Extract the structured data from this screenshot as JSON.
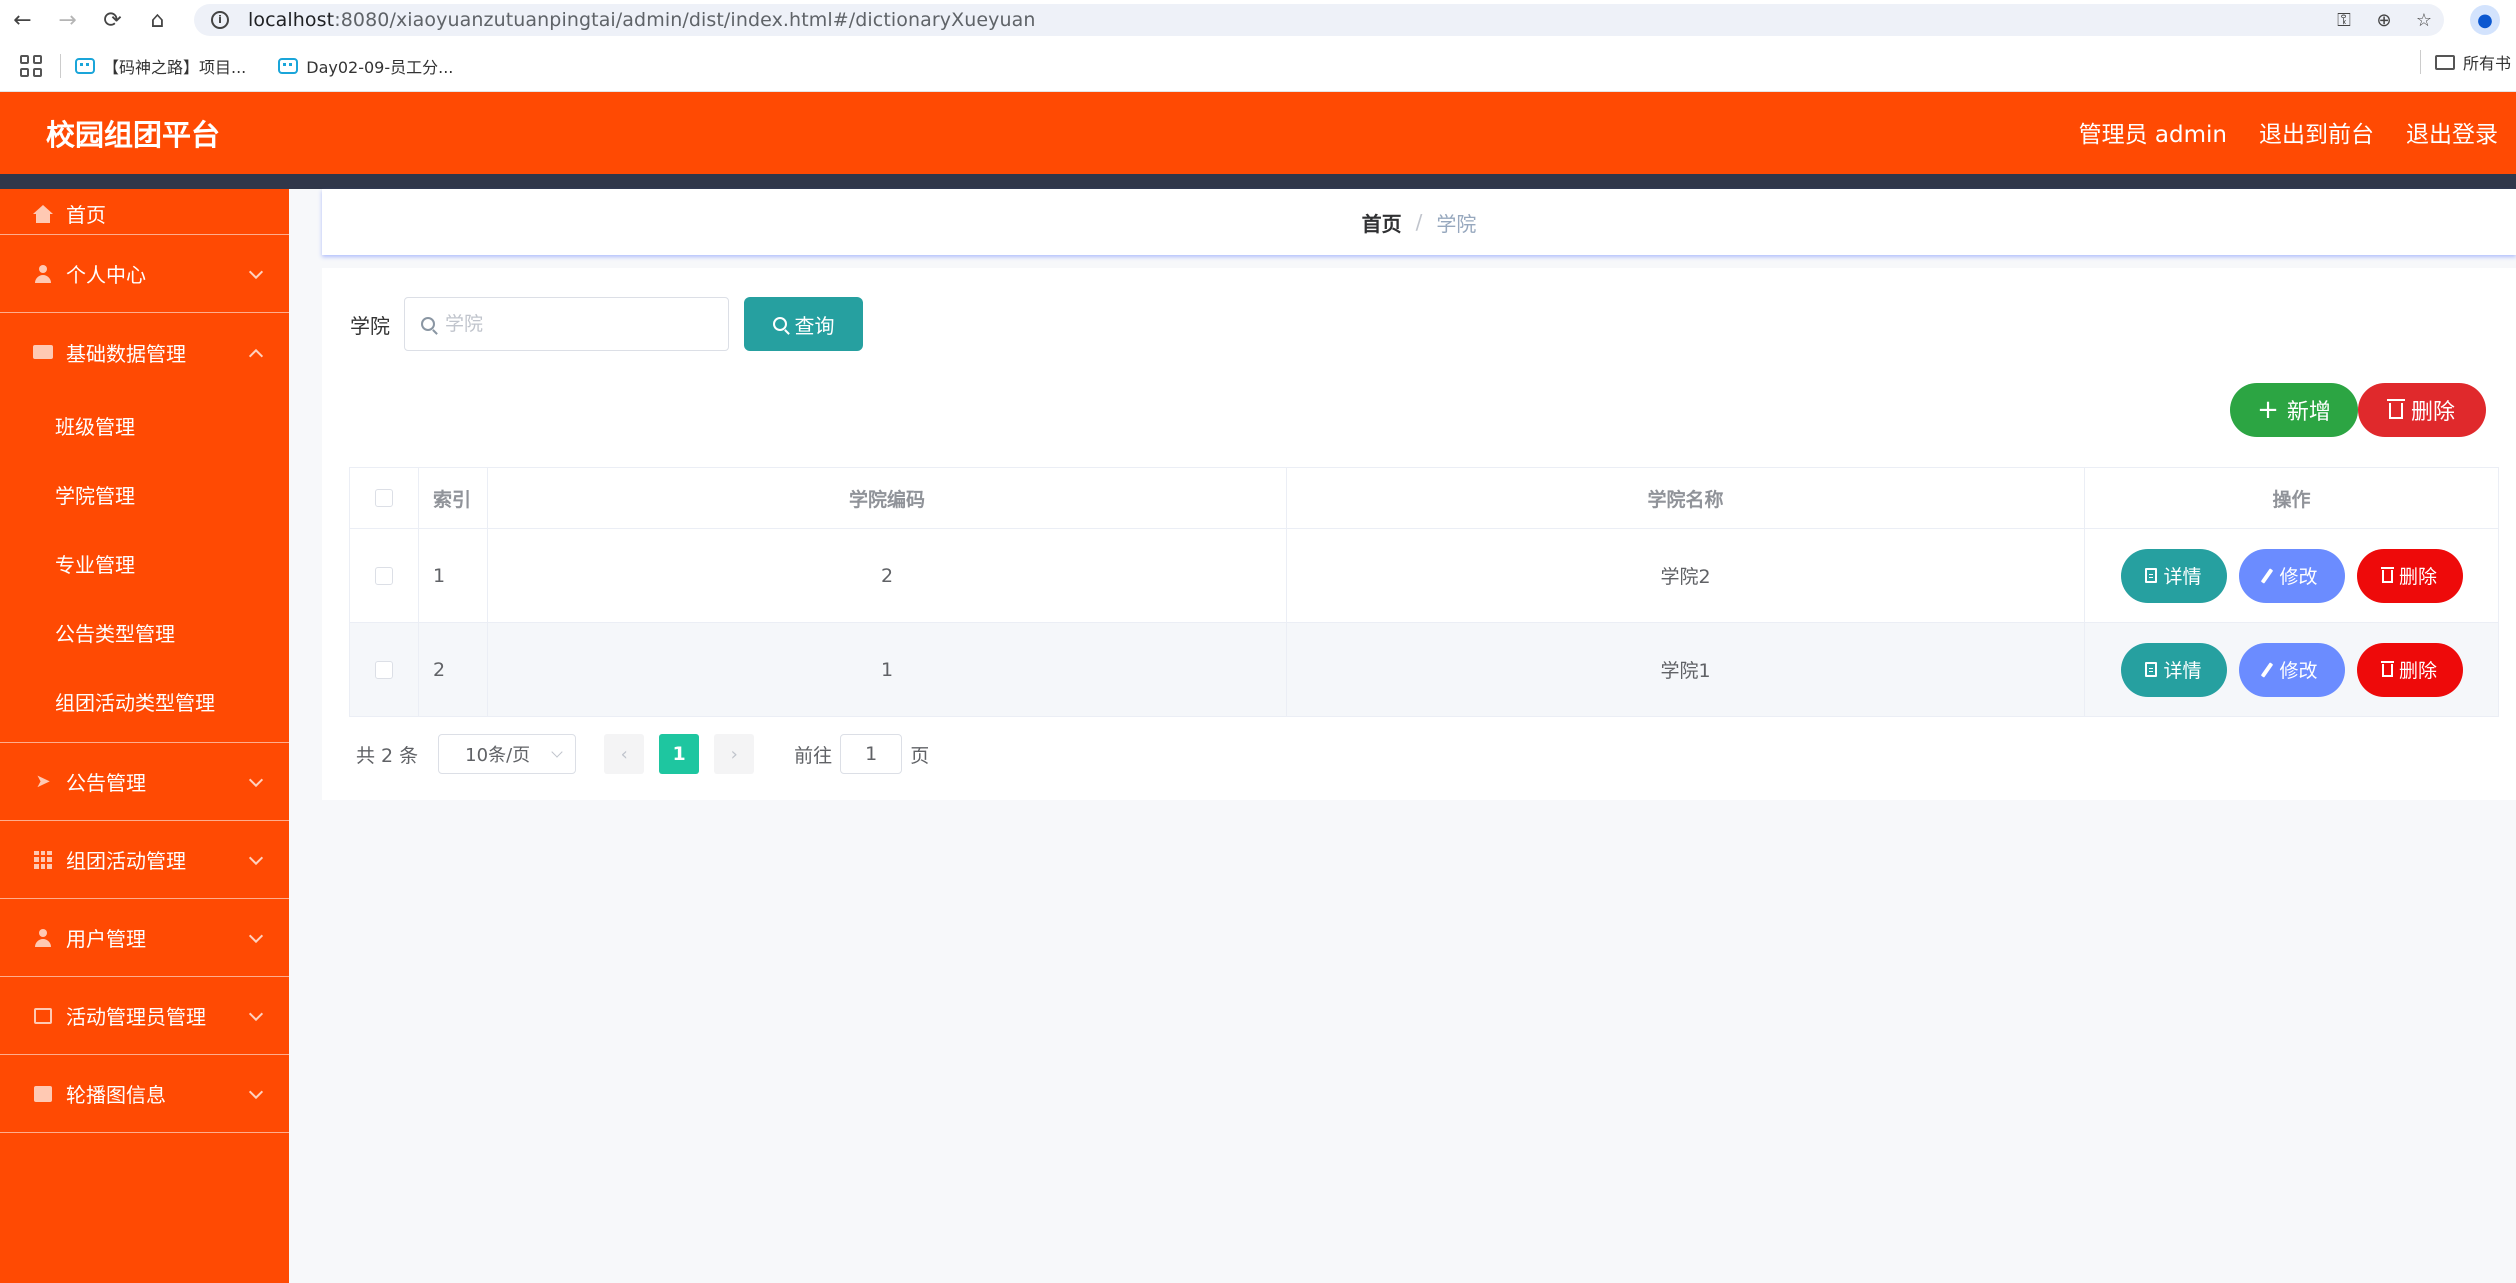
{
  "browser": {
    "url_host": "localhost",
    "url_path": ":8080/xiaoyuanzutuanpingtai/admin/dist/index.html#/dictionaryXueyuan",
    "bookmarks": [
      "【码神之路】项目...",
      "Day02-09-员工分..."
    ],
    "bookmarks_right": "所有书"
  },
  "header": {
    "title": "校园组团平台",
    "links": [
      "管理员 admin",
      "退出到前台",
      "退出登录"
    ]
  },
  "sidebar": {
    "items": [
      {
        "label": "首页",
        "icon": "home-icon"
      },
      {
        "label": "个人中心",
        "icon": "user-icon"
      },
      {
        "label": "基础数据管理",
        "icon": "ticket-icon"
      },
      {
        "label": "公告管理",
        "icon": "send-icon"
      },
      {
        "label": "组团活动管理",
        "icon": "grid-icon"
      },
      {
        "label": "用户管理",
        "icon": "user-icon"
      },
      {
        "label": "活动管理员管理",
        "icon": "copy-icon"
      },
      {
        "label": "轮播图信息",
        "icon": "monitor-icon"
      }
    ],
    "submenu": [
      "班级管理",
      "学院管理",
      "专业管理",
      "公告类型管理",
      "组团活动类型管理"
    ]
  },
  "breadcrumb": {
    "home": "首页",
    "separator": "/",
    "current": "学院"
  },
  "search": {
    "label": "学院",
    "placeholder": "学院",
    "button": "查询"
  },
  "actions": {
    "add": "新增",
    "delete": "删除"
  },
  "table": {
    "headers": [
      "索引",
      "学院编码",
      "学院名称",
      "操作"
    ],
    "rows": [
      {
        "index": "1",
        "code": "2",
        "name": "学院2"
      },
      {
        "index": "2",
        "code": "1",
        "name": "学院1"
      }
    ],
    "row_actions": {
      "detail": "详情",
      "edit": "修改",
      "delete": "删除"
    }
  },
  "pagination": {
    "total": "共 2 条",
    "page_size": "10条/页",
    "prev": "‹",
    "current_page": "1",
    "next": "›",
    "goto_label": "前往",
    "goto_value": "1",
    "page_suffix": "页"
  },
  "colors": {
    "primary": "#ff4a03",
    "teal": "#26a0a0",
    "green": "#2ca543",
    "red": "#e0292c",
    "blue": "#6b8cff"
  }
}
